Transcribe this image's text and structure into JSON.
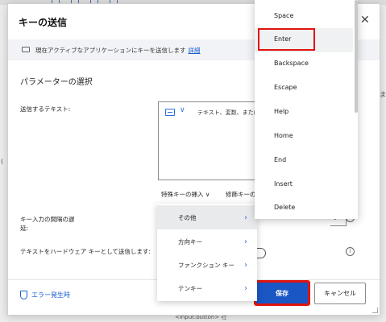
{
  "dialog": {
    "title": "キーの送信",
    "close_glyph": "✕"
  },
  "infobar": {
    "text": "現在アクティブなアプリケーションにキーを送信します",
    "link": "詳細"
  },
  "section_title": "パラメーターの選択",
  "fields": {
    "text_label": "送信するテキスト:",
    "text_placeholder": "テキスト、変数、または",
    "special_key_button": "特殊キーの挿入",
    "modifier_button": "修飾キーの",
    "interval_label_line1": "キー入力の間隔の遅",
    "interval_label_line2": "延:",
    "hardware_label": "テキストをハードウェア キーとして送信します:"
  },
  "footer": {
    "error_link": "エラー発生時",
    "save_label": "保存",
    "cancel_label": "キャンセル"
  },
  "submenu": {
    "items": [
      {
        "label": "その他",
        "active": true
      },
      {
        "label": "方向キー",
        "active": false
      },
      {
        "label": "ファンクション キー",
        "active": false
      },
      {
        "label": "テンキー",
        "active": false
      }
    ]
  },
  "keylist": {
    "items": [
      {
        "label": "Space"
      },
      {
        "label": "Enter"
      },
      {
        "label": "Backspace"
      },
      {
        "label": "Escape"
      },
      {
        "label": "Help"
      },
      {
        "label": "Home"
      },
      {
        "label": "End"
      },
      {
        "label": "Insert"
      },
      {
        "label": "Delete"
      }
    ]
  },
  "background": {
    "right_text": "ま",
    "left_text": "(",
    "bottom_text": "<input:button> 社"
  },
  "colors": {
    "accent": "#1a56c4",
    "highlight": "#e0140e",
    "link": "#1a5fd0"
  }
}
